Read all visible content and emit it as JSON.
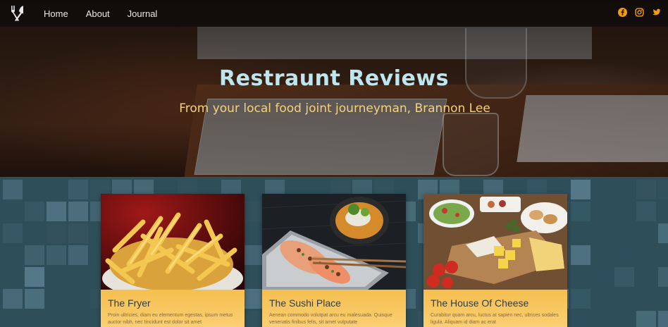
{
  "nav": {
    "links": [
      "Home",
      "About",
      "Journal"
    ],
    "socials": [
      "facebook-icon",
      "instagram-icon",
      "twitter-icon"
    ]
  },
  "hero": {
    "title": "Restraunt Reviews",
    "subtitle": "From your local food joint journeyman, Brannon Lee"
  },
  "cards": [
    {
      "title": "The Fryer",
      "text": "Proin ultricies, diam eu elementum egestas, ipsum metus auctor nibh, nec tincidunt est dolor sit amet"
    },
    {
      "title": "The Sushi Place",
      "text": "Aenean commodo volutpat arcu eu malesuada. Quisque venenatis finibus felis, sit amet vulputate"
    },
    {
      "title": "The House Of Cheese",
      "text": "Curabitur quam arcu, luctus at sapien nec, ultrices sodales ligula. Aliquam id diam ac erat"
    }
  ],
  "colors": {
    "hero_title": "#bfe6ee",
    "hero_subtitle": "#f5d27a",
    "card_bg": "#f8c85a",
    "tile_bg": "#2e4e5a",
    "facebook": "#f39c12",
    "instagram": "#f39c12",
    "twitter": "#f39c12"
  }
}
